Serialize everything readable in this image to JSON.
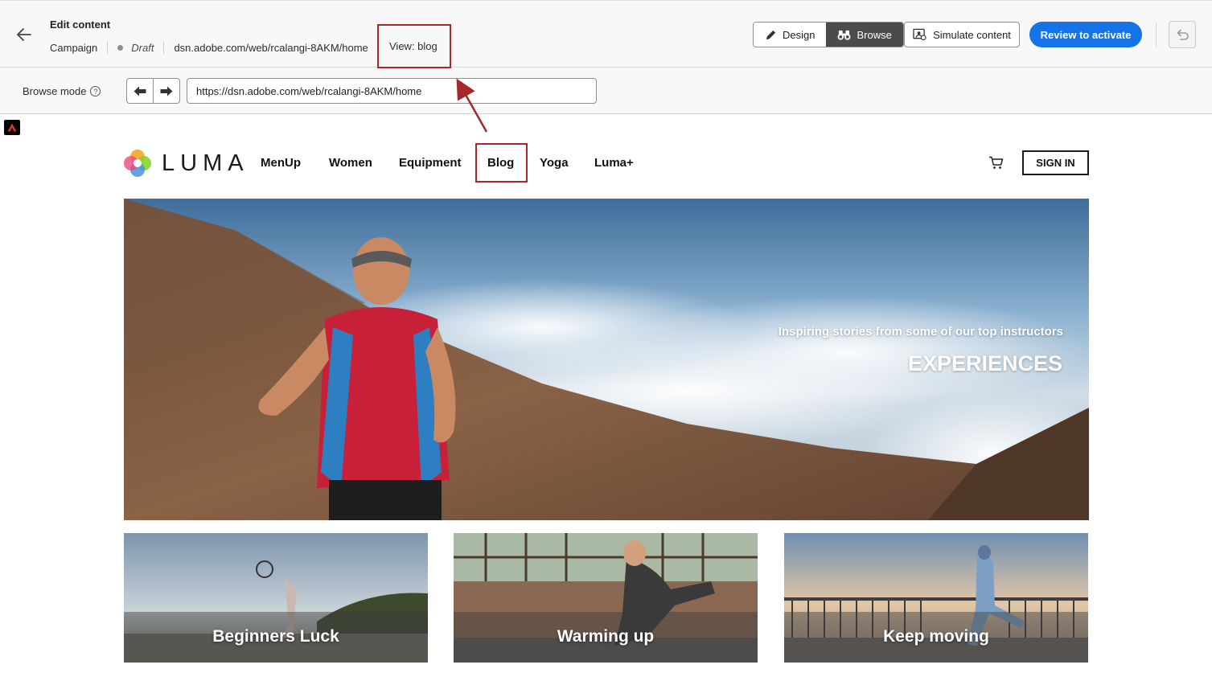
{
  "header": {
    "title": "Edit content",
    "breadcrumbs": {
      "type": "Campaign",
      "status": "Draft",
      "url": "dsn.adobe.com/web/rcalangi-8AKM/home",
      "view": "View: blog"
    },
    "mode_toggle": {
      "design_label": "Design",
      "browse_label": "Browse",
      "active": "Browse"
    },
    "simulate_label": "Simulate content",
    "review_label": "Review to activate"
  },
  "browse_bar": {
    "label": "Browse mode",
    "url_value": "https://dsn.adobe.com/web/rcalangi-8AKM/home"
  },
  "site": {
    "logo_text": "LUMA",
    "nav": [
      "MenUp",
      "Women",
      "Equipment",
      "Blog",
      "Yoga",
      "Luma+"
    ],
    "highlighted_nav": "Blog",
    "signin_label": "SIGN IN",
    "hero": {
      "subtitle": "Inspiring stories from some of our top instructors",
      "title": "EXPERIENCES"
    },
    "cards": [
      {
        "label": "Beginners Luck"
      },
      {
        "label": "Warming up"
      },
      {
        "label": "Keep moving"
      }
    ]
  },
  "colors": {
    "accent_blue": "#1473e6",
    "annotation_red": "#a8272a",
    "active_toggle": "#4b4b4b"
  },
  "icons": [
    "back-arrow-icon",
    "pencil-icon",
    "binoculars-icon",
    "simulate-icon",
    "undo-icon",
    "help-icon",
    "arrow-left-icon",
    "arrow-right-icon",
    "adobe-icon",
    "luma-logo-icon",
    "cart-icon"
  ]
}
